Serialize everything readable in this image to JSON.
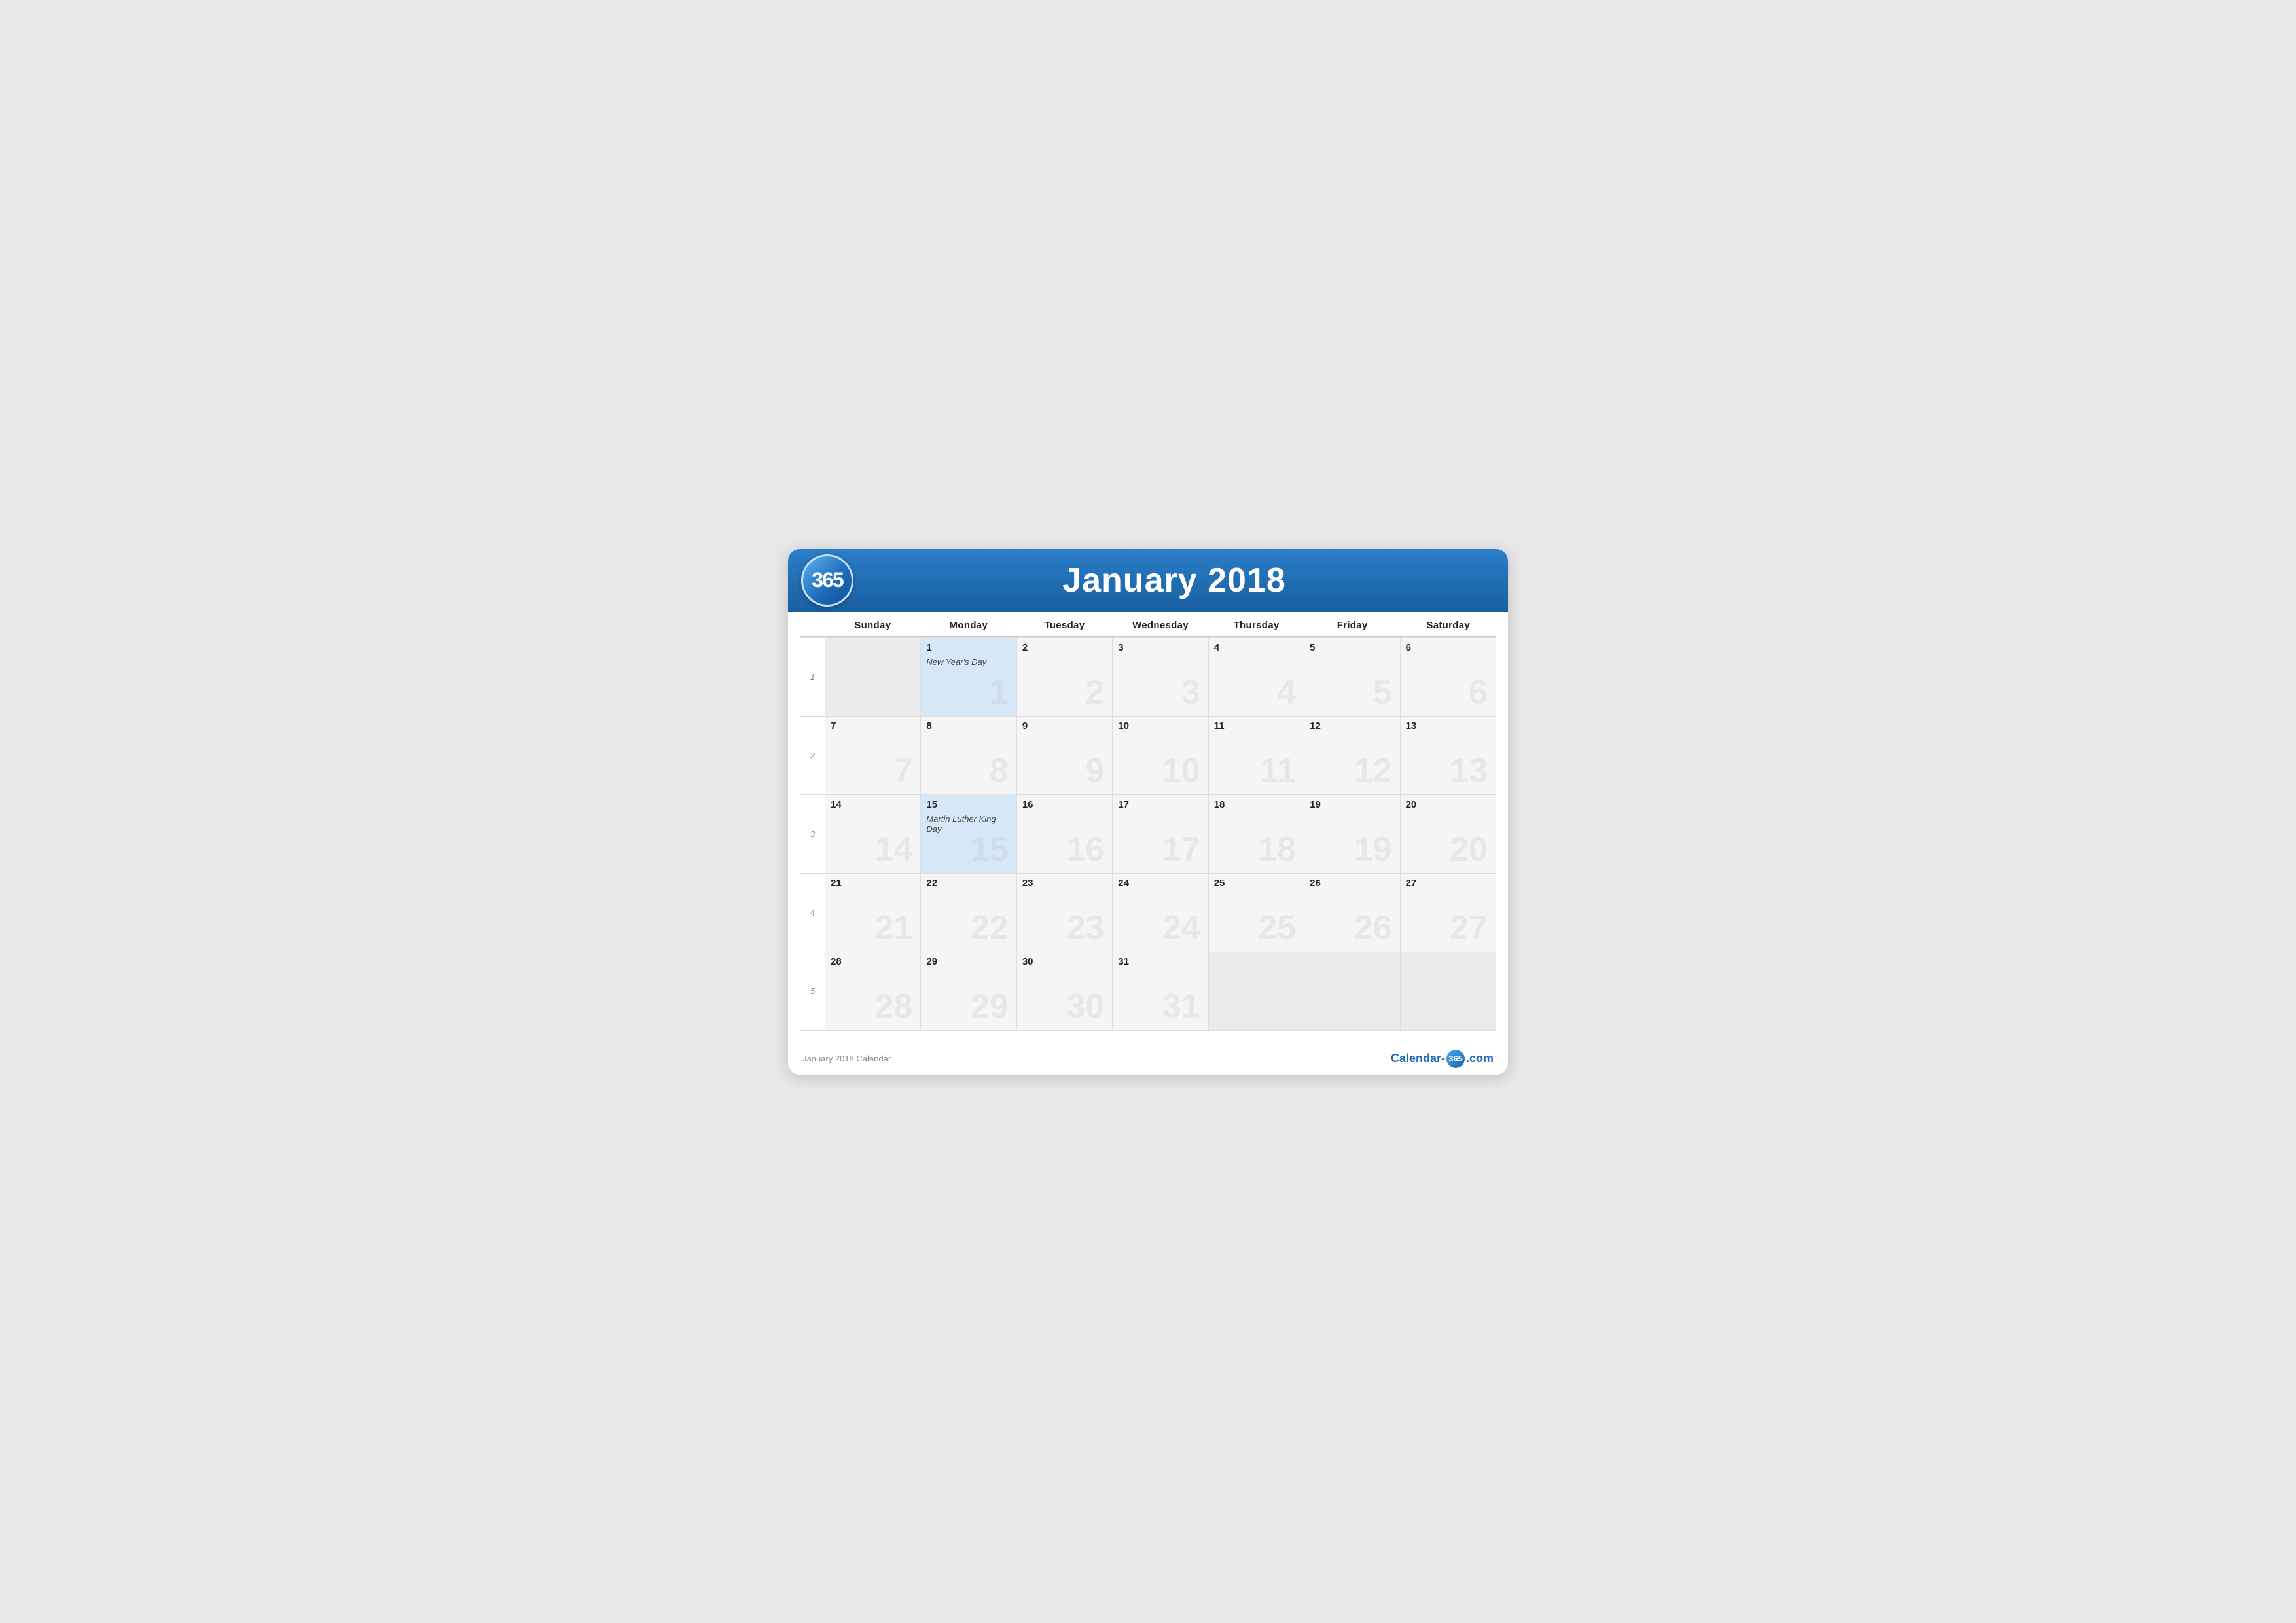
{
  "header": {
    "logo_text": "365",
    "title": "January 2018"
  },
  "day_headers": [
    "Sunday",
    "Monday",
    "Tuesday",
    "Wednesday",
    "Thursday",
    "Friday",
    "Saturday"
  ],
  "weeks": [
    {
      "week_num": "1",
      "days": [
        {
          "date": "",
          "in_month": false,
          "holiday": false,
          "event": ""
        },
        {
          "date": "1",
          "in_month": true,
          "holiday": true,
          "event": "New Year's Day"
        },
        {
          "date": "2",
          "in_month": true,
          "holiday": false,
          "event": ""
        },
        {
          "date": "3",
          "in_month": true,
          "holiday": false,
          "event": ""
        },
        {
          "date": "4",
          "in_month": true,
          "holiday": false,
          "event": ""
        },
        {
          "date": "5",
          "in_month": true,
          "holiday": false,
          "event": ""
        },
        {
          "date": "6",
          "in_month": true,
          "holiday": false,
          "event": ""
        }
      ]
    },
    {
      "week_num": "2",
      "days": [
        {
          "date": "7",
          "in_month": true,
          "holiday": false,
          "event": ""
        },
        {
          "date": "8",
          "in_month": true,
          "holiday": false,
          "event": ""
        },
        {
          "date": "9",
          "in_month": true,
          "holiday": false,
          "event": ""
        },
        {
          "date": "10",
          "in_month": true,
          "holiday": false,
          "event": ""
        },
        {
          "date": "11",
          "in_month": true,
          "holiday": false,
          "event": ""
        },
        {
          "date": "12",
          "in_month": true,
          "holiday": false,
          "event": ""
        },
        {
          "date": "13",
          "in_month": true,
          "holiday": false,
          "event": ""
        }
      ]
    },
    {
      "week_num": "3",
      "days": [
        {
          "date": "14",
          "in_month": true,
          "holiday": false,
          "event": ""
        },
        {
          "date": "15",
          "in_month": true,
          "holiday": true,
          "event": "Martin Luther King Day"
        },
        {
          "date": "16",
          "in_month": true,
          "holiday": false,
          "event": ""
        },
        {
          "date": "17",
          "in_month": true,
          "holiday": false,
          "event": ""
        },
        {
          "date": "18",
          "in_month": true,
          "holiday": false,
          "event": ""
        },
        {
          "date": "19",
          "in_month": true,
          "holiday": false,
          "event": ""
        },
        {
          "date": "20",
          "in_month": true,
          "holiday": false,
          "event": ""
        }
      ]
    },
    {
      "week_num": "4",
      "days": [
        {
          "date": "21",
          "in_month": true,
          "holiday": false,
          "event": ""
        },
        {
          "date": "22",
          "in_month": true,
          "holiday": false,
          "event": ""
        },
        {
          "date": "23",
          "in_month": true,
          "holiday": false,
          "event": ""
        },
        {
          "date": "24",
          "in_month": true,
          "holiday": false,
          "event": ""
        },
        {
          "date": "25",
          "in_month": true,
          "holiday": false,
          "event": ""
        },
        {
          "date": "26",
          "in_month": true,
          "holiday": false,
          "event": ""
        },
        {
          "date": "27",
          "in_month": true,
          "holiday": false,
          "event": ""
        }
      ]
    },
    {
      "week_num": "5",
      "days": [
        {
          "date": "28",
          "in_month": true,
          "holiday": false,
          "event": ""
        },
        {
          "date": "29",
          "in_month": true,
          "holiday": false,
          "event": ""
        },
        {
          "date": "30",
          "in_month": true,
          "holiday": false,
          "event": ""
        },
        {
          "date": "31",
          "in_month": true,
          "holiday": false,
          "event": ""
        },
        {
          "date": "",
          "in_month": false,
          "holiday": false,
          "event": ""
        },
        {
          "date": "",
          "in_month": false,
          "holiday": false,
          "event": ""
        },
        {
          "date": "",
          "in_month": false,
          "holiday": false,
          "event": ""
        }
      ]
    }
  ],
  "footer": {
    "label": "January 2018 Calendar",
    "brand_prefix": "Calendar-",
    "brand_badge": "365",
    "brand_suffix": ".com"
  }
}
